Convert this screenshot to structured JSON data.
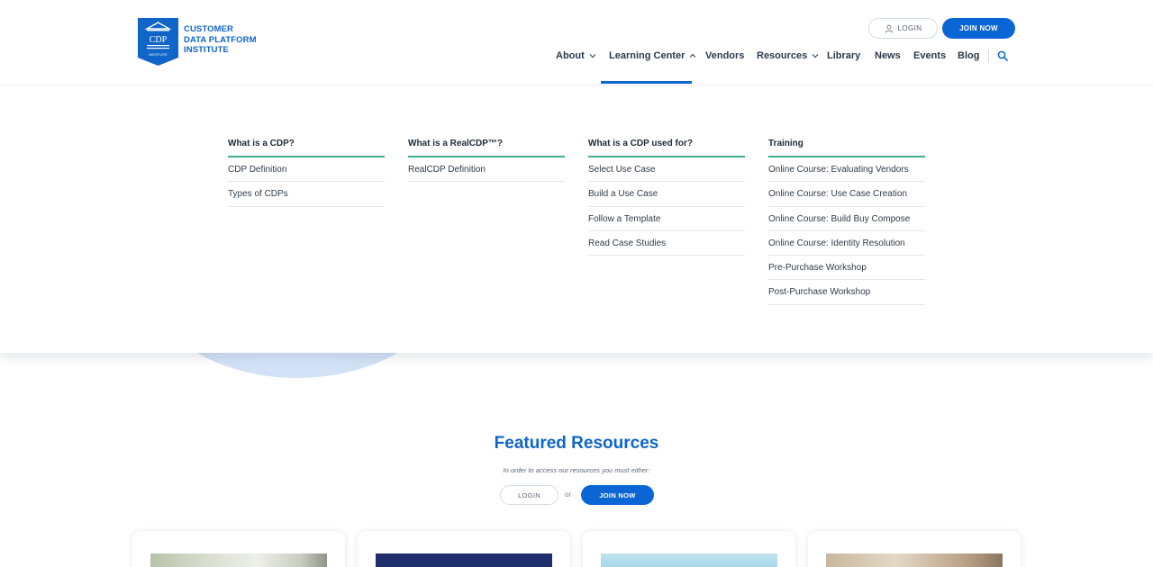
{
  "brand": {
    "line1": "CUSTOMER",
    "line2": "DATA PLATFORM",
    "line3": "INSTITUTE",
    "badge_text": "CDP",
    "badge_sub": "INSTITUTE",
    "color": "#0f65c8"
  },
  "header": {
    "login_label": "LOGIN",
    "join_label": "JOIN NOW"
  },
  "nav": {
    "items": [
      {
        "label": "About",
        "icon": "chevron-down-icon"
      },
      {
        "label": "Learning Center",
        "icon": "chevron-up-icon",
        "active": true
      },
      {
        "label": "Vendors"
      },
      {
        "label": "Resources",
        "icon": "chevron-down-icon"
      },
      {
        "label": "Library"
      },
      {
        "label": "News"
      },
      {
        "label": "Events"
      },
      {
        "label": "Blog"
      }
    ],
    "search_icon": "search-icon"
  },
  "mega_menu": {
    "columns": [
      {
        "heading": "What is a CDP?",
        "links": [
          "CDP Definition",
          "Types of CDPs"
        ]
      },
      {
        "heading": "What is a RealCDP™?",
        "links": [
          "RealCDP Definition"
        ]
      },
      {
        "heading": "What is a CDP used for?",
        "links": [
          "Select Use Case",
          "Build a Use Case",
          "Follow a Template",
          "Read Case Studies"
        ]
      },
      {
        "heading": "Training",
        "links": [
          "Online Course: Evaluating Vendors",
          "Online Course: Use Case Creation",
          "Online Course: Build Buy Compose",
          "Online Course: Identity Resolution",
          "Pre-Purchase Workshop",
          "Post-Purchase Workshop"
        ]
      }
    ]
  },
  "featured": {
    "title": "Featured Resources",
    "subtitle": "In order to access our resources you must either:",
    "login_label": "LOGIN",
    "or_label": "or",
    "join_label": "JOIN NOW"
  },
  "colors": {
    "accent": "#0a66d4",
    "menu_underline": "#3fae8a"
  }
}
